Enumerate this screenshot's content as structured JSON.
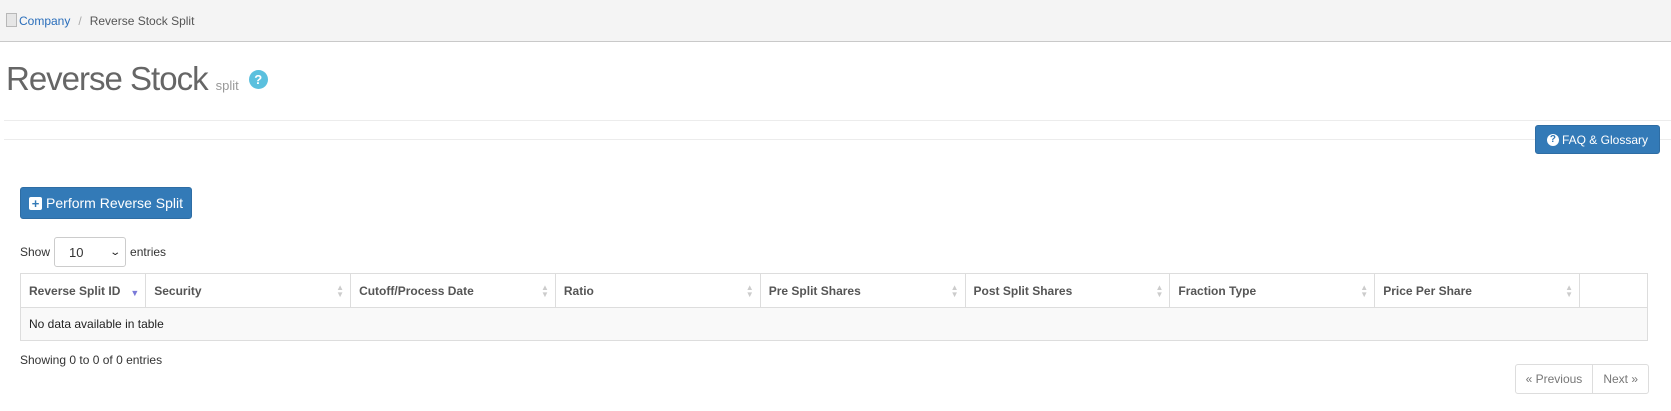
{
  "breadcrumb": {
    "icon": "page-icon",
    "parent": "Company",
    "current": "Reverse Stock Split"
  },
  "header": {
    "title": "Reverse Stock",
    "subtitle": "split",
    "help_icon": "question-circle-icon"
  },
  "faq_button": {
    "label": "FAQ & Glossary",
    "icon": "question-circle-icon"
  },
  "perform_button": {
    "label": "Perform Reverse Split",
    "icon": "plus-square-icon"
  },
  "length": {
    "show_label": "Show",
    "value": "10",
    "entries_label": "entries"
  },
  "table": {
    "columns": [
      "Reverse Split ID",
      "Security",
      "Cutoff/Process Date",
      "Ratio",
      "Pre Split Shares",
      "Post Split Shares",
      "Fraction Type",
      "Price Per Share",
      ""
    ],
    "empty_message": "No data available in table",
    "sorted_column": "Reverse Split ID",
    "sort_direction": "descending"
  },
  "info": "Showing 0 to 0 of 0 entries",
  "pagination": {
    "previous": "« Previous",
    "next": "Next »"
  },
  "colors": {
    "primary": "#337ab7",
    "help": "#5bc0de",
    "link": "#2a6ebb"
  }
}
